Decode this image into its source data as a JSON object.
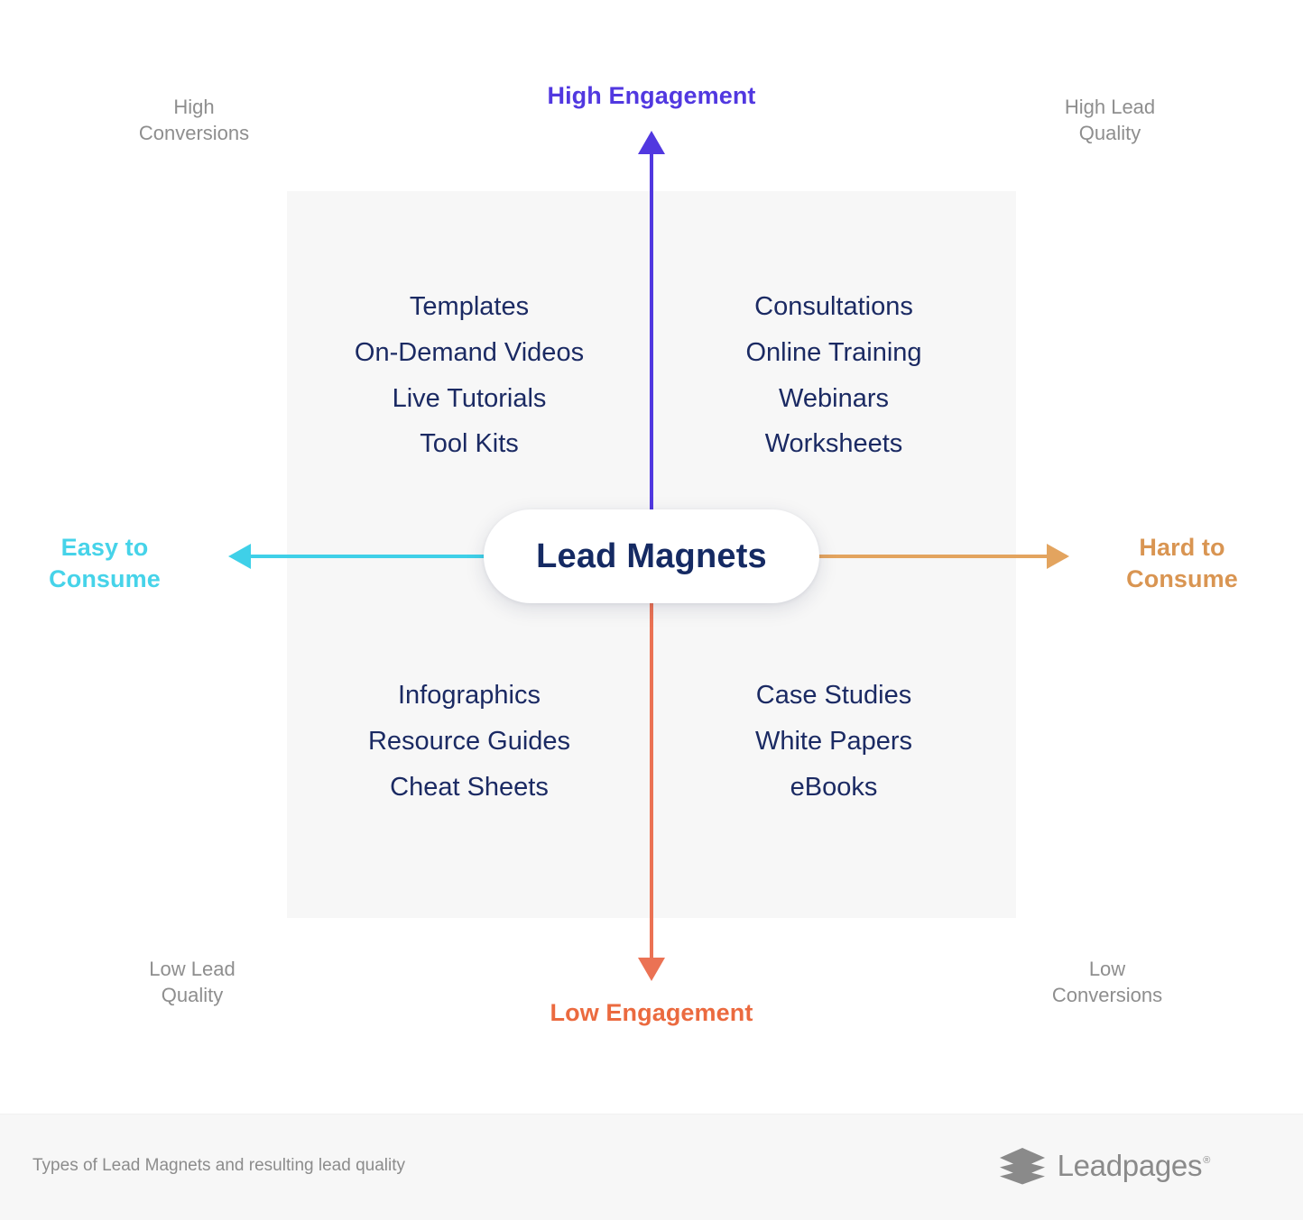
{
  "diagram": {
    "title": "Lead Magnets",
    "axes": {
      "top": {
        "label": "High Engagement",
        "color": "#5138e0"
      },
      "bottom": {
        "label": "Low Engagement",
        "color": "#eb6a3f"
      },
      "left": {
        "label": "Easy to\nConsume",
        "color": "#46d3e9"
      },
      "right": {
        "label": "Hard to\nConsume",
        "color": "#d99552"
      }
    },
    "corners": {
      "top_left": "High\nConversions",
      "top_right": "High Lead\nQuality",
      "bottom_left": "Low Lead\nQuality",
      "bottom_right": "Low\nConversions"
    },
    "quadrants": {
      "top_left": {
        "items": [
          "Templates",
          "On-Demand Videos",
          "Live Tutorials",
          "Tool Kits"
        ]
      },
      "top_right": {
        "items": [
          "Consultations",
          "Online Training",
          "Webinars",
          "Worksheets"
        ]
      },
      "bottom_left": {
        "items": [
          "Infographics",
          "Resource Guides",
          "Cheat Sheets"
        ]
      },
      "bottom_right": {
        "items": [
          "Case Studies",
          "White Papers",
          "eBooks"
        ]
      }
    },
    "item_color": "#1b2a63",
    "plate_color": "#f7f7f7"
  },
  "footer": {
    "caption": "Types of Lead Magnets and resulting lead quality",
    "brand_name": "Leadpages",
    "brand_registered": "®",
    "brand_color": "#8a8a8a"
  }
}
